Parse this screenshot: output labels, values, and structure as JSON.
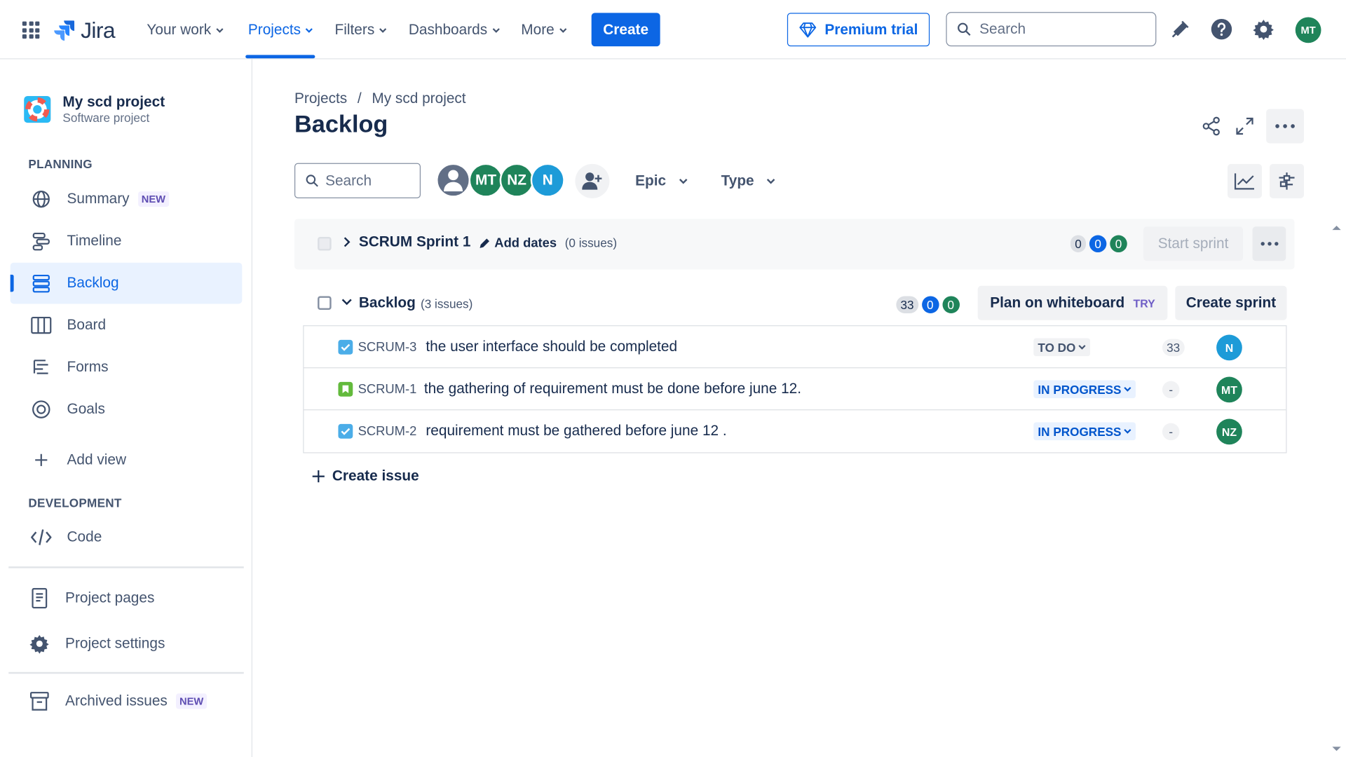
{
  "topnav": {
    "logo_text": "Jira",
    "items": [
      {
        "label": "Your work"
      },
      {
        "label": "Projects"
      },
      {
        "label": "Filters"
      },
      {
        "label": "Dashboards"
      },
      {
        "label": "More"
      }
    ],
    "active_item": "Projects",
    "create_label": "Create",
    "premium_label": "Premium trial",
    "search_placeholder": "Search",
    "user_initials": "MT"
  },
  "sidebar": {
    "project_name": "My scd project",
    "project_type": "Software project",
    "planning_label": "PLANNING",
    "items": [
      {
        "label": "Summary",
        "badge": "NEW"
      },
      {
        "label": "Timeline"
      },
      {
        "label": "Backlog"
      },
      {
        "label": "Board"
      },
      {
        "label": "Forms"
      },
      {
        "label": "Goals"
      },
      {
        "label": "Add view"
      }
    ],
    "development_label": "DEVELOPMENT",
    "code_label": "Code",
    "project_pages_label": "Project pages",
    "project_settings_label": "Project settings",
    "archived_label": "Archived issues",
    "archived_badge": "NEW"
  },
  "main": {
    "breadcrumb": [
      "Projects",
      "My scd project"
    ],
    "breadcrumb_sep": "/",
    "title": "Backlog",
    "search_placeholder": "Search",
    "people": [
      {
        "initials": "",
        "color": "#626f86"
      },
      {
        "initials": "MT",
        "color": "#1f845a"
      },
      {
        "initials": "NZ",
        "color": "#1f845a"
      },
      {
        "initials": "N",
        "color": "#1d9bd8"
      }
    ],
    "epic_label": "Epic",
    "type_label": "Type",
    "sprint": {
      "name": "SCRUM Sprint 1",
      "add_dates": "Add dates",
      "issue_count": "(0 issues)",
      "counts": [
        "0",
        "0",
        "0"
      ],
      "start_label": "Start sprint"
    },
    "backlog": {
      "name": "Backlog",
      "issue_count": "(3 issues)",
      "counts": [
        "33",
        "0",
        "0"
      ],
      "plan_label": "Plan on whiteboard",
      "try_label": "TRY",
      "create_sprint_label": "Create sprint"
    },
    "issues": [
      {
        "key": "SCRUM-3",
        "summary": "the user interface should be completed",
        "status": "TO DO",
        "estimate": "33",
        "assignee": "N",
        "assignee_color": "#1d9bd8",
        "type": "task"
      },
      {
        "key": "SCRUM-1",
        "summary": "the gathering of requirement must be done before june 12.",
        "status": "IN PROGRESS",
        "estimate": "-",
        "assignee": "MT",
        "assignee_color": "#1f845a",
        "type": "story"
      },
      {
        "key": "SCRUM-2",
        "summary": "requirement must be gathered before june 12 .",
        "status": "IN PROGRESS",
        "estimate": "-",
        "assignee": "NZ",
        "assignee_color": "#1f845a",
        "type": "task"
      }
    ],
    "create_issue_label": "Create issue"
  },
  "colors": {
    "accent": "#0c66e4",
    "green": "#1f845a",
    "teal": "#1d9bd8"
  }
}
